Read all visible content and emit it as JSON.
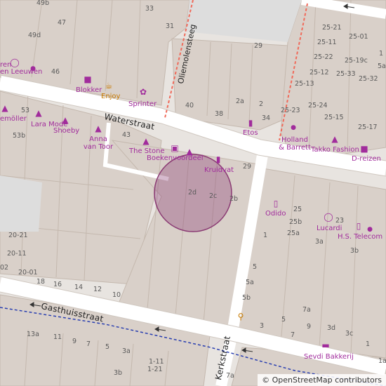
{
  "map": {
    "streets": [
      "Waterstraat",
      "Gasthuisstraat",
      "Kerkstraat",
      "Oliemolensteeg"
    ],
    "house_numbers": [
      "49b",
      "33",
      "47",
      "49d",
      "31",
      "29",
      "46",
      "40",
      "38",
      "2a",
      "2",
      "34",
      "53",
      "53b",
      "43",
      "29",
      "2d",
      "2c",
      "2b",
      "1",
      "25",
      "25b",
      "25a",
      "3a",
      "23",
      "3b",
      "20-21",
      "20-11",
      "20-01",
      "02",
      "18",
      "16",
      "14",
      "12",
      "10",
      "5",
      "5a",
      "5b",
      "7a",
      "5",
      "3",
      "9",
      "7",
      "3d",
      "3c",
      "1",
      "13a",
      "11",
      "9",
      "7",
      "5",
      "3a",
      "3b",
      "1-11",
      "1-21",
      "7a",
      "25-21",
      "25-01",
      "25-11",
      "25-22",
      "25-19c",
      "25-12",
      "25-33",
      "25-32",
      "25-13",
      "25-24",
      "25-23",
      "25-15",
      "25-17",
      "5a",
      "1",
      "1a"
    ],
    "pois": [
      "ren",
      "en Leeuwen",
      "Blokker",
      "Enjoy",
      "Sprinter",
      "emöller",
      "Lara Mode",
      "Shoeby",
      "Anna van Toor",
      "The Stone",
      "Boekenvoordeel",
      "Kruidvat",
      "Etos",
      "Holland & Barrett",
      "Takko Fashion",
      "D-reizen",
      "Odido",
      "Lucardi",
      "H.S. Telecom",
      "Sevdi Bakkerij"
    ],
    "icons": [
      "jewelry-icon",
      "dot-icon",
      "shop-icon",
      "cafe-icon",
      "sports-icon",
      "clothes-icon",
      "book-icon",
      "chemist-icon",
      "bakery-icon",
      "restaurant-icon",
      "phone-icon",
      "travel-icon",
      "one-way-arrow-icon"
    ],
    "colors": {
      "road": "#ffffff",
      "building": "#d9d0c9",
      "building_outline": "#c4b8ae",
      "poi": "#a12c9c",
      "highlight_circle": "#8a3a73",
      "footpath": "#f06a5a",
      "bus_route": "#2a3fb0"
    }
  },
  "attribution": {
    "symbol": "©",
    "text": "OpenStreetMap contributors"
  }
}
